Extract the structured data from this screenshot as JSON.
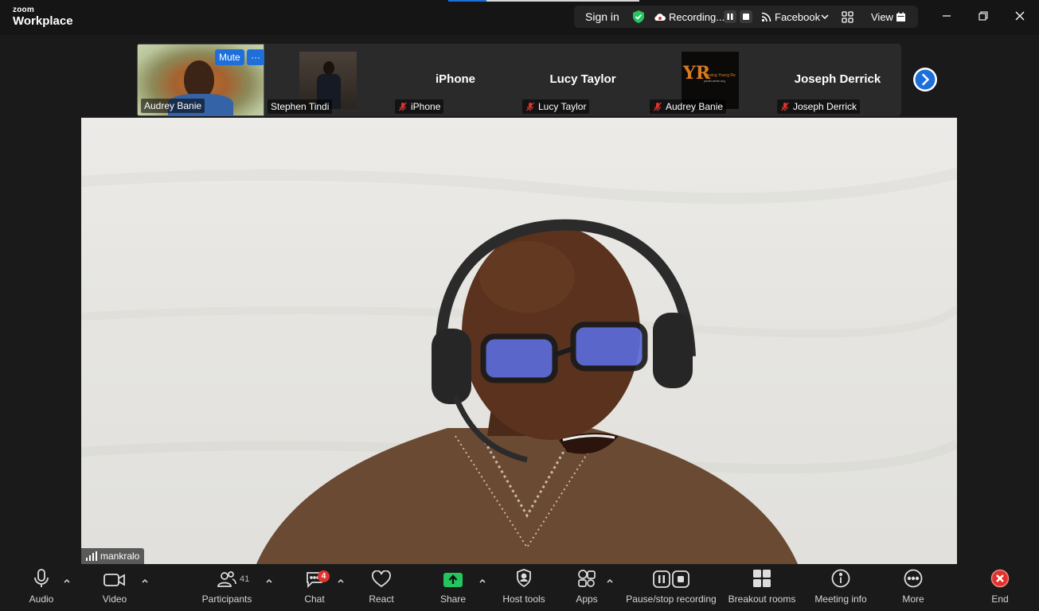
{
  "app": {
    "brand_small": "zoom",
    "brand_large": "Workplace"
  },
  "topbar": {
    "sign_in": "Sign in",
    "recording_status": "Recording...",
    "livestream": "Facebook",
    "view": "View"
  },
  "gallery": {
    "tiles": [
      {
        "name": "Audrey Banie",
        "mute_chip": "Mute",
        "more_chip": "···"
      },
      {
        "name": "Stephen Tindi"
      },
      {
        "display_name": "iPhone",
        "name": "iPhone",
        "muted": true
      },
      {
        "display_name": "Lucy Taylor",
        "name": "Lucy Taylor",
        "muted": true
      },
      {
        "name": "Audrey Banie",
        "muted": true,
        "logo_text": "YR",
        "logo_line1": "Raising Young Re",
        "logo_line2": "youth-arise.org"
      },
      {
        "display_name": "Joseph Derrick",
        "name": "Joseph Derrick",
        "muted": true
      }
    ]
  },
  "speaker": {
    "name": "mankralo"
  },
  "toolbar": {
    "audio": "Audio",
    "video": "Video",
    "participants": "Participants",
    "participants_count": "41",
    "chat": "Chat",
    "chat_badge": "4",
    "react": "React",
    "share": "Share",
    "host_tools": "Host tools",
    "apps": "Apps",
    "recording": "Pause/stop recording",
    "breakout_rooms": "Breakout rooms",
    "meeting_info": "Meeting info",
    "more": "More",
    "end": "End"
  },
  "colors": {
    "accent_blue": "#1f6fdb",
    "share_green": "#23c55e",
    "end_red": "#e0332d",
    "verified_green": "#23c55e"
  }
}
